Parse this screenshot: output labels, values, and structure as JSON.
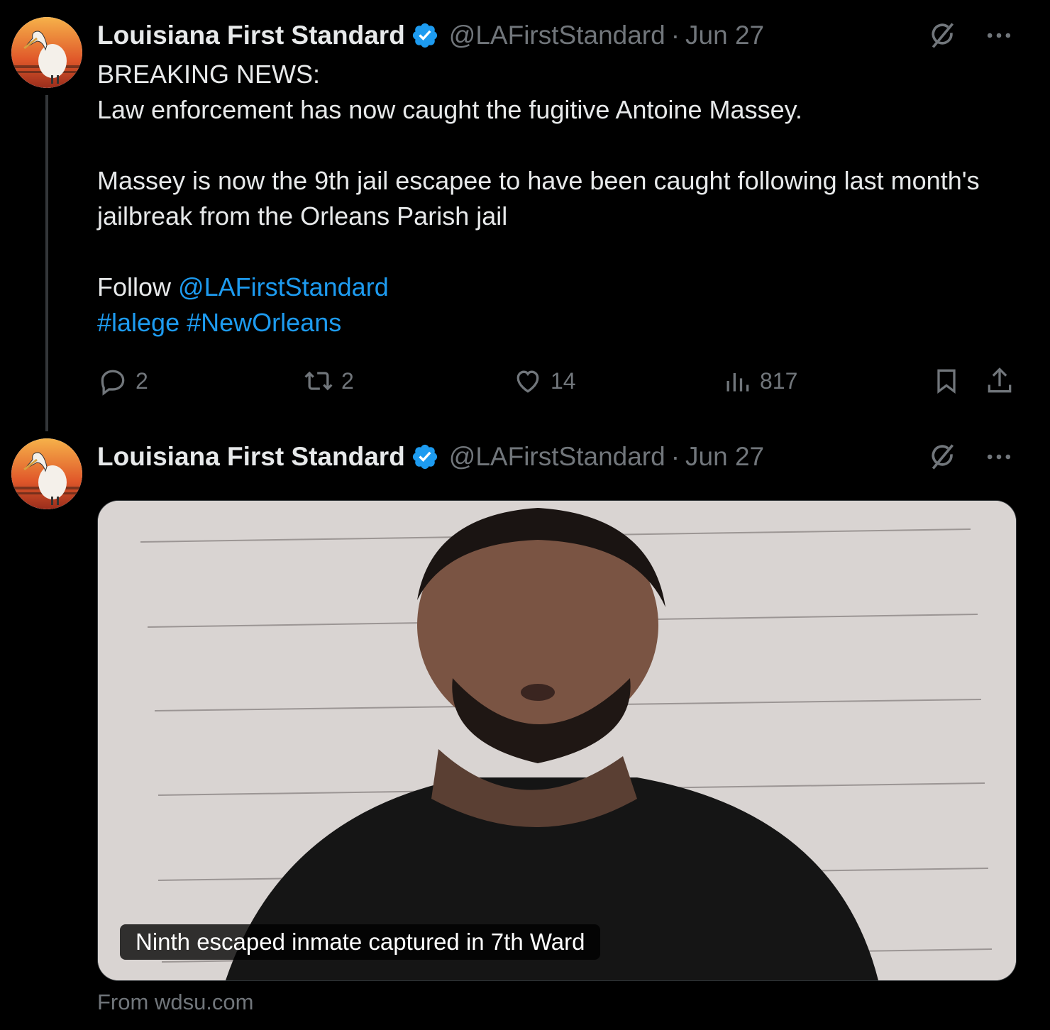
{
  "tweets": [
    {
      "author_name": "Louisiana First Standard",
      "handle": "@LAFirstStandard",
      "separator": "·",
      "date": "Jun 27",
      "text": {
        "line1": "BREAKING NEWS:",
        "line2": "Law enforcement has now caught the fugitive Antoine Massey.",
        "line3": "Massey is now the 9th jail escapee to have been caught following last month's jailbreak from the Orleans Parish jail",
        "follow_prefix": "Follow",
        "follow_mention": "@LAFirstStandard",
        "hashtag1": "#lalege",
        "hashtag2": "#NewOrleans"
      },
      "actions": {
        "replies": "2",
        "reposts": "2",
        "likes": "14",
        "views": "817"
      }
    },
    {
      "author_name": "Louisiana First Standard",
      "handle": "@LAFirstStandard",
      "separator": "·",
      "date": "Jun 27",
      "card": {
        "caption": "Ninth escaped inmate captured in 7th Ward",
        "source": "From wdsu.com"
      }
    }
  ],
  "icons": {
    "verified": "verified-badge-icon",
    "grok": "grok-icon",
    "more": "more-icon",
    "reply": "reply-icon",
    "repost": "repost-icon",
    "like": "heart-icon",
    "views": "views-icon",
    "bookmark": "bookmark-icon",
    "share": "share-icon"
  },
  "colors": {
    "background": "#000000",
    "text": "#e7e9ea",
    "muted": "#71767b",
    "link": "#1d9bf0",
    "verified": "#1d9bf0"
  }
}
